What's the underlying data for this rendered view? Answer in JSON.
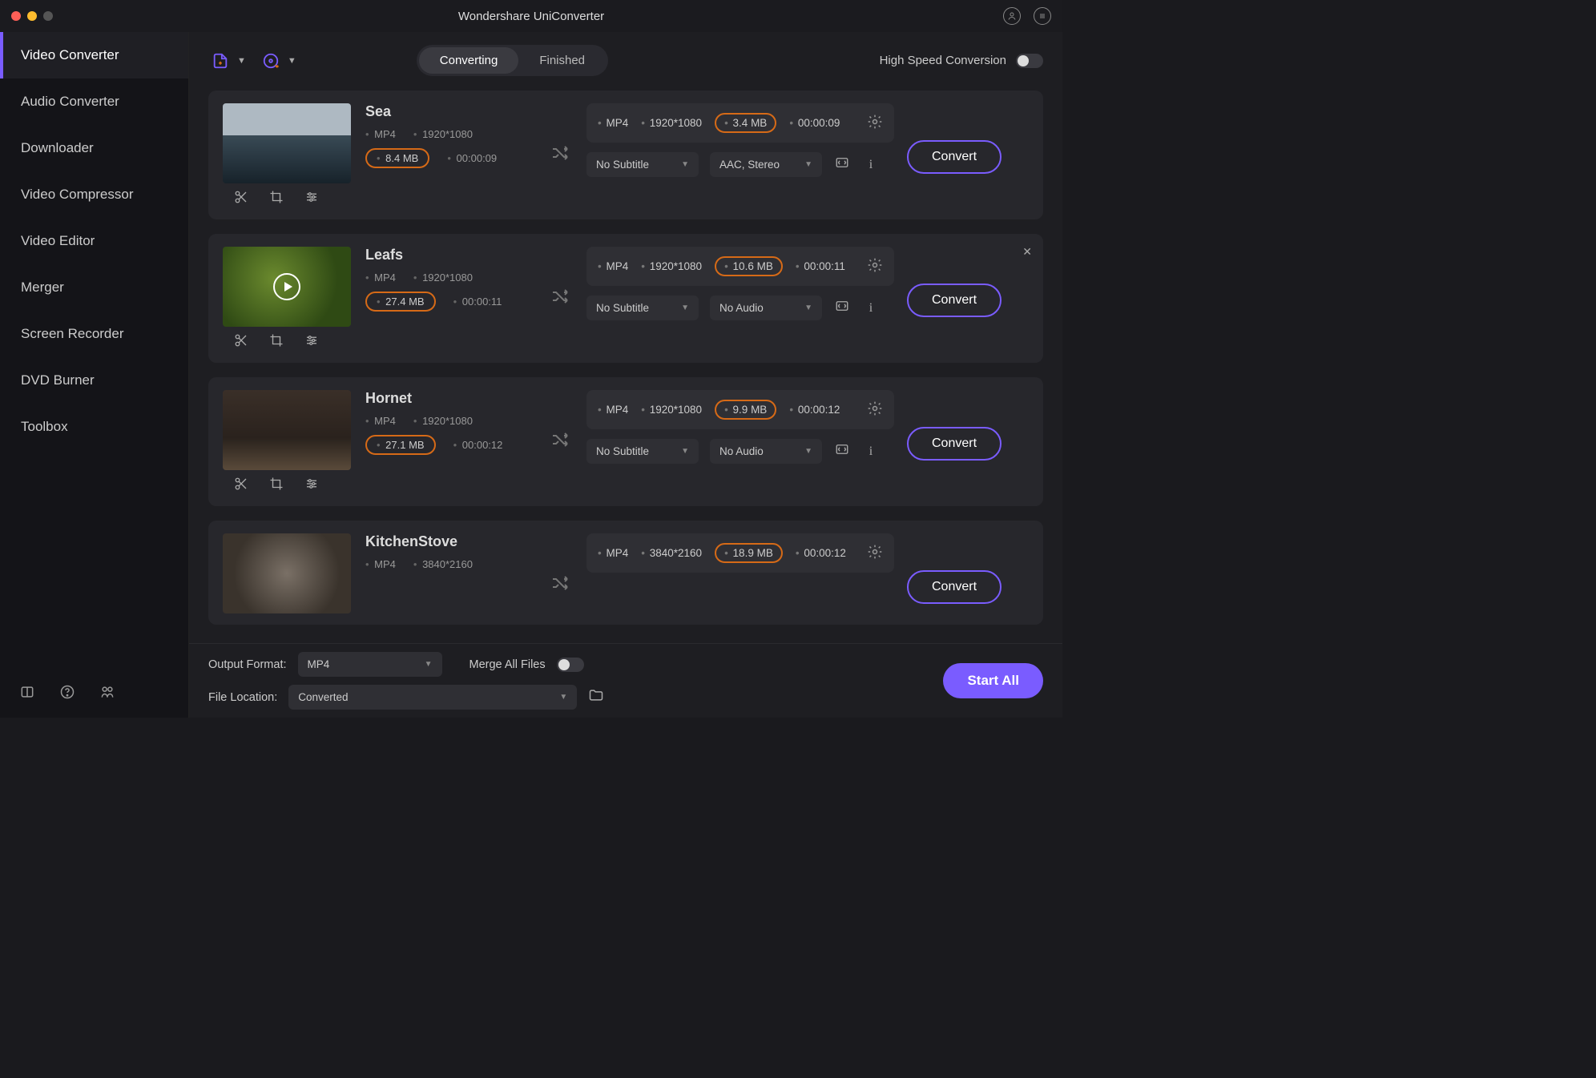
{
  "app_title": "Wondershare UniConverter",
  "sidebar": {
    "items": [
      {
        "label": "Video Converter",
        "active": true
      },
      {
        "label": "Audio Converter"
      },
      {
        "label": "Downloader"
      },
      {
        "label": "Video Compressor"
      },
      {
        "label": "Video Editor"
      },
      {
        "label": "Merger"
      },
      {
        "label": "Screen Recorder"
      },
      {
        "label": "DVD Burner"
      },
      {
        "label": "Toolbox"
      }
    ]
  },
  "toolbar": {
    "tabs": {
      "converting": "Converting",
      "finished": "Finished"
    },
    "high_speed_label": "High Speed Conversion"
  },
  "items": [
    {
      "title": "Sea",
      "src": {
        "format": "MP4",
        "resolution": "1920*1080",
        "size": "8.4 MB",
        "duration": "00:00:09"
      },
      "dst": {
        "format": "MP4",
        "resolution": "1920*1080",
        "size": "3.4 MB",
        "duration": "00:00:09"
      },
      "subtitle": "No Subtitle",
      "audio": "AAC, Stereo",
      "convert": "Convert",
      "show_play": false,
      "show_close": false,
      "thumb": "th-sea"
    },
    {
      "title": "Leafs",
      "src": {
        "format": "MP4",
        "resolution": "1920*1080",
        "size": "27.4 MB",
        "duration": "00:00:11"
      },
      "dst": {
        "format": "MP4",
        "resolution": "1920*1080",
        "size": "10.6 MB",
        "duration": "00:00:11"
      },
      "subtitle": "No Subtitle",
      "audio": "No Audio",
      "convert": "Convert",
      "show_play": true,
      "show_close": true,
      "thumb": "th-leafs"
    },
    {
      "title": "Hornet",
      "src": {
        "format": "MP4",
        "resolution": "1920*1080",
        "size": "27.1 MB",
        "duration": "00:00:12"
      },
      "dst": {
        "format": "MP4",
        "resolution": "1920*1080",
        "size": "9.9 MB",
        "duration": "00:00:12"
      },
      "subtitle": "No Subtitle",
      "audio": "No Audio",
      "convert": "Convert",
      "show_play": false,
      "show_close": false,
      "thumb": "th-hornet"
    },
    {
      "title": "KitchenStove",
      "src": {
        "format": "MP4",
        "resolution": "3840*2160",
        "size": "",
        "duration": ""
      },
      "dst": {
        "format": "MP4",
        "resolution": "3840*2160",
        "size": "18.9 MB",
        "duration": "00:00:12"
      },
      "subtitle": "",
      "audio": "",
      "convert": "Convert",
      "show_play": false,
      "show_close": false,
      "thumb": "th-stove"
    }
  ],
  "footer": {
    "output_format_label": "Output Format:",
    "output_format_value": "MP4",
    "merge_label": "Merge All Files",
    "file_location_label": "File Location:",
    "file_location_value": "Converted",
    "start_all": "Start All"
  }
}
